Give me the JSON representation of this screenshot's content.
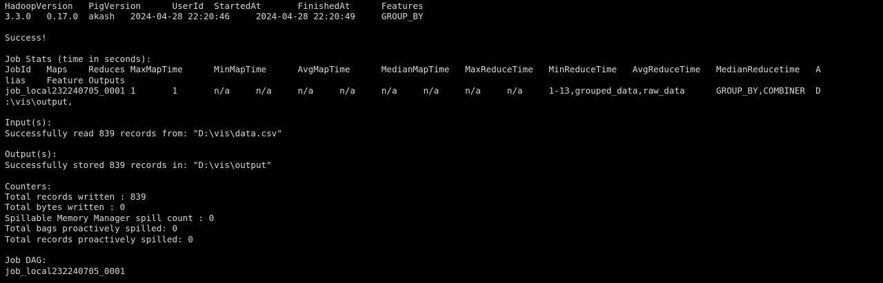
{
  "terminal": {
    "fg_color": "#d9d9d9",
    "bg_color": "#000000",
    "lines": [
      "HadoopVersion   PigVersion      UserId  StartedAt       FinishedAt      Features",
      "3.3.0   0.17.0  akash   2024-04-28 22:20:46     2024-04-28 22:20:49     GROUP_BY",
      "",
      "Success!",
      "",
      "Job Stats (time in seconds):",
      "JobId   Maps    Reduces MaxMapTime      MinMapTime      AvgMapTime      MedianMapTime   MaxReduceTime   MinReduceTime   AvgReduceTime   MedianReducetime   A",
      "lias    Feature Outputs",
      "job_local232240705_0001 1       1       n/a     n/a     n/a     n/a     n/a     n/a     n/a     n/a     1-13,grouped_data,raw_data      GROUP_BY,COMBINER  D",
      ":\\vis\\output,",
      "",
      "Input(s):",
      "Successfully read 839 records from: \"D:\\vis\\data.csv\"",
      "",
      "Output(s):",
      "Successfully stored 839 records in: \"D:\\vis\\output\"",
      "",
      "Counters:",
      "Total records written : 839",
      "Total bytes written : 0",
      "Spillable Memory Manager spill count : 0",
      "Total bags proactively spilled: 0",
      "Total records proactively spilled: 0",
      "",
      "Job DAG:",
      "job_local232240705_0001"
    ]
  }
}
